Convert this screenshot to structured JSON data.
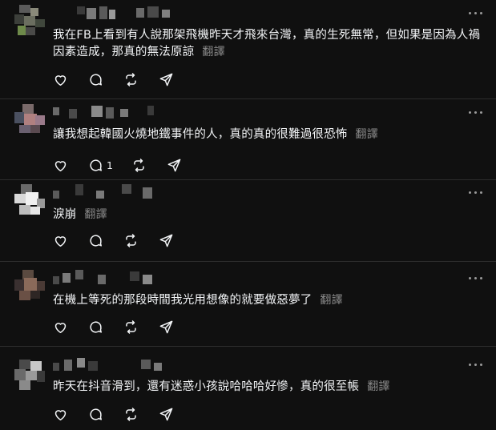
{
  "translate_label": "翻譯",
  "posts": [
    {
      "text": "我在FB上看到有人說那架飛機昨天才飛來台灣，真的生死無常，但如果是因為人禍因素造成，那真的無法原諒",
      "reply_count": ""
    },
    {
      "text": "讓我想起韓國火燒地鐵事件的人，真的真的很難過很恐怖",
      "reply_count": "1"
    },
    {
      "text": "淚崩",
      "reply_count": ""
    },
    {
      "text": "在機上等死的那段時間我光用想像的就要做惡夢了",
      "reply_count": ""
    },
    {
      "text": "昨天在抖音滑到，還有迷惑小孩說哈哈哈好慘，真的很至帳",
      "reply_count": ""
    }
  ],
  "icons": {
    "like": "heart-icon",
    "reply": "comment-icon",
    "repost": "repost-icon",
    "share": "send-icon",
    "more": "more-icon"
  }
}
